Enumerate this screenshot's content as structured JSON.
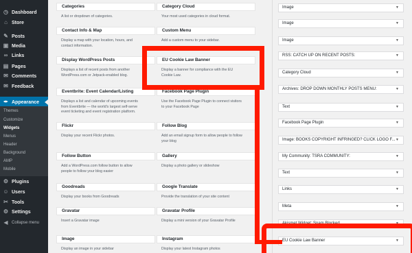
{
  "admin_menu": {
    "items": [
      {
        "icon": "dashboard-icon",
        "glyph": "◷",
        "label": "Dashboard"
      },
      {
        "icon": "store-icon",
        "glyph": "⌂",
        "label": "Store"
      },
      {
        "icon": "posts-icon",
        "glyph": "✎",
        "label": "Posts"
      },
      {
        "icon": "media-icon",
        "glyph": "▣",
        "label": "Media"
      },
      {
        "icon": "links-icon",
        "glyph": "∞",
        "label": "Links"
      },
      {
        "icon": "pages-icon",
        "glyph": "▤",
        "label": "Pages"
      },
      {
        "icon": "comments-icon",
        "glyph": "✉",
        "label": "Comments"
      },
      {
        "icon": "feedback-icon",
        "glyph": "✉",
        "label": "Feedback"
      },
      {
        "icon": "appearance-icon",
        "glyph": "✒",
        "label": "Appearance"
      },
      {
        "icon": "plugins-icon",
        "glyph": "⚙",
        "label": "Plugins"
      },
      {
        "icon": "users-icon",
        "glyph": "☺",
        "label": "Users"
      },
      {
        "icon": "tools-icon",
        "glyph": "✂",
        "label": "Tools"
      },
      {
        "icon": "settings-icon",
        "glyph": "⚙",
        "label": "Settings"
      },
      {
        "icon": "collapse-icon",
        "glyph": "◀",
        "label": "Collapse menu"
      }
    ],
    "appearance_submenu": [
      "Themes",
      "Customize",
      "Widgets",
      "Menus",
      "Header",
      "Background",
      "AMP",
      "Mobile"
    ]
  },
  "available_widgets": [
    {
      "title": "Categories",
      "desc": [
        "A list or dropdown of categories."
      ]
    },
    {
      "title": "Category Cloud",
      "desc": [
        "Your most used categories in cloud format."
      ]
    },
    {
      "title": "Contact Info & Map",
      "desc": [
        "Display a map with your location, hours, and",
        "contact information."
      ]
    },
    {
      "title": "Custom Menu",
      "desc": [
        "Add a custom menu to your sidebar."
      ]
    },
    {
      "title": "Display WordPress Posts",
      "desc": [
        "Displays a list of recent posts from another",
        "WordPress.com or Jetpack-enabled blog."
      ]
    },
    {
      "title": "EU Cookie Law Banner",
      "desc": [
        "Display a banner for compliance with the EU",
        "Cookie Law."
      ]
    },
    {
      "title": "Eventbrite: Event Calendar/Listing",
      "desc": [
        "Displays a list and calendar of upcoming events",
        "from Eventbrite — the world's largest self-serve",
        "event ticketing and event registration platform."
      ]
    },
    {
      "title": "Facebook Page Plugin",
      "desc": [
        "Use the Facebook Page Plugin to connect visitors",
        "to your Facebook Page"
      ]
    },
    {
      "title": "Flickr",
      "desc": [
        "Display your recent Flickr photos."
      ]
    },
    {
      "title": "Follow Blog",
      "desc": [
        "Add an email signup form to allow people to follow",
        "your blog"
      ]
    },
    {
      "title": "Follow Button",
      "desc": [
        "Add a WordPress.com follow button to allow",
        "people to follow your blog easier"
      ]
    },
    {
      "title": "Gallery",
      "desc": [
        "Display a photo gallery or slideshow"
      ]
    },
    {
      "title": "Goodreads",
      "desc": [
        "Display your books from Goodreads"
      ]
    },
    {
      "title": "Google Translate",
      "desc": [
        "Provide the translation of your site content"
      ]
    },
    {
      "title": "Gravatar",
      "desc": [
        "Insert a Gravatar image"
      ]
    },
    {
      "title": "Gravatar Profile",
      "desc": [
        "Display a mini version of your Gravatar Profile"
      ]
    },
    {
      "title": "Image",
      "desc": [
        "Display an image in your sidebar"
      ]
    },
    {
      "title": "Instagram",
      "desc": [
        "Display your latest Instagram photos"
      ]
    }
  ],
  "sidebar_widgets": [
    "Image",
    "Image",
    "Image",
    "RSS: CATCH UP ON RECENT POSTS:",
    "Category Cloud",
    "Archives: DROP DOWN MONTHLY POSTS MENU:",
    "Text",
    "Facebook Page Plugin",
    "Image: BOOKS COPYRIGHT INFRINGED? CLICK LOGO F...",
    "My Community: TSRA COMMUNITY:",
    "Text",
    "Links",
    "Meta",
    "Akismet Widget: Spam Blocked",
    "EU Cookie Law Banner"
  ],
  "caret_glyph": "▼",
  "annotation_color": "#ff1a00"
}
